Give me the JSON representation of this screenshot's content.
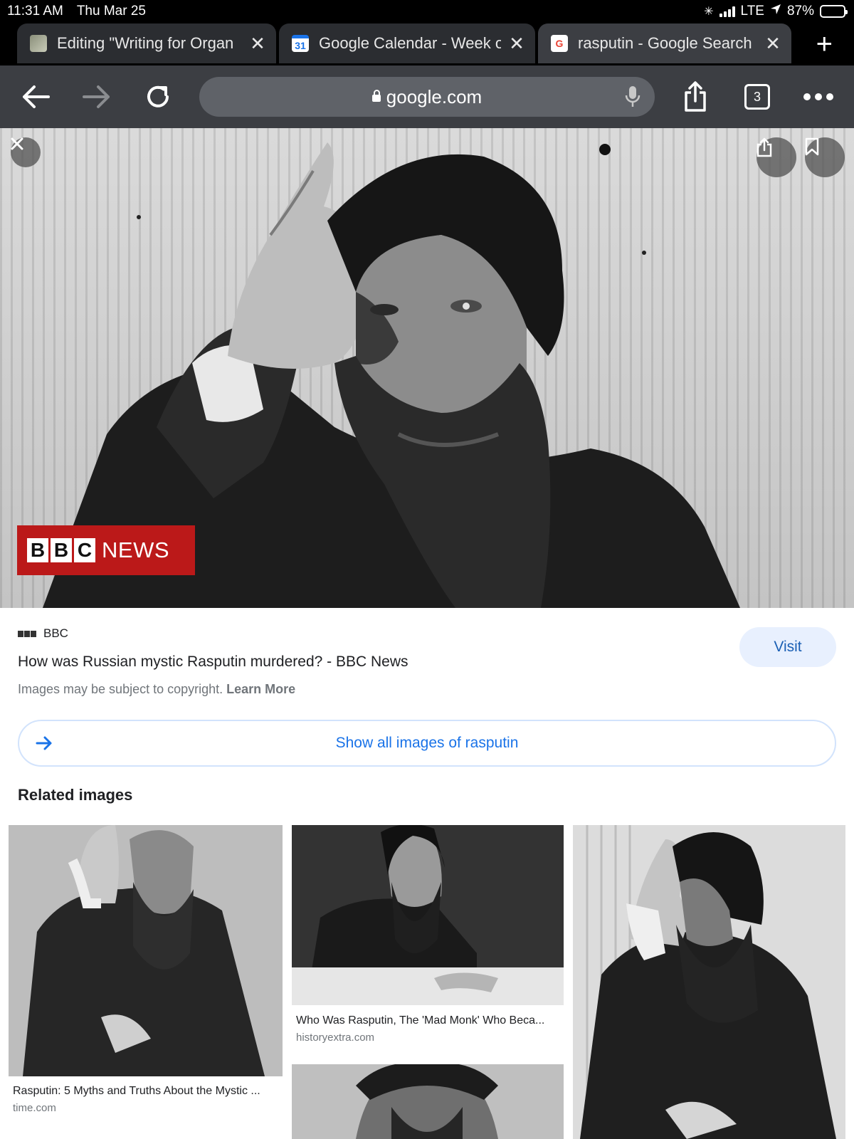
{
  "status_bar": {
    "time": "11:31 AM",
    "date": "Thu Mar 25",
    "network": "LTE",
    "battery": "87%",
    "battery_level": 0.87
  },
  "tabs": [
    {
      "title": "Editing \"Writing for Organ",
      "favicon": "image-favicon",
      "active": false
    },
    {
      "title": "Google Calendar - Week of",
      "favicon": "calendar-favicon",
      "favicon_text": "31",
      "active": false
    },
    {
      "title": "rasputin - Google Search",
      "favicon": "google-favicon",
      "favicon_text": "G",
      "active": true
    }
  ],
  "toolbar": {
    "url": "google.com",
    "tab_count": "3"
  },
  "viewer": {
    "logo_letters": [
      "B",
      "B",
      "C"
    ],
    "logo_word": "NEWS"
  },
  "result": {
    "source": "BBC",
    "title": "How was Russian mystic Rasputin murdered? - BBC News",
    "copyright_text": "Images may be subject to copyright.",
    "learn_more": "Learn More",
    "visit_label": "Visit"
  },
  "show_all_label": "Show all images of rasputin",
  "related": {
    "heading": "Related images",
    "items": [
      {
        "caption": "Rasputin: 5 Myths and Truths About the Mystic ...",
        "domain": "time.com"
      },
      {
        "caption": "Who Was Rasputin, The 'Mad Monk' Who Beca...",
        "domain": "historyextra.com"
      },
      {
        "caption": "",
        "domain": ""
      }
    ]
  },
  "colors": {
    "tab_strip": "#000000",
    "toolbar": "#3c3e43",
    "bbc_red": "#bb1919",
    "link_blue": "#1a73e8"
  }
}
